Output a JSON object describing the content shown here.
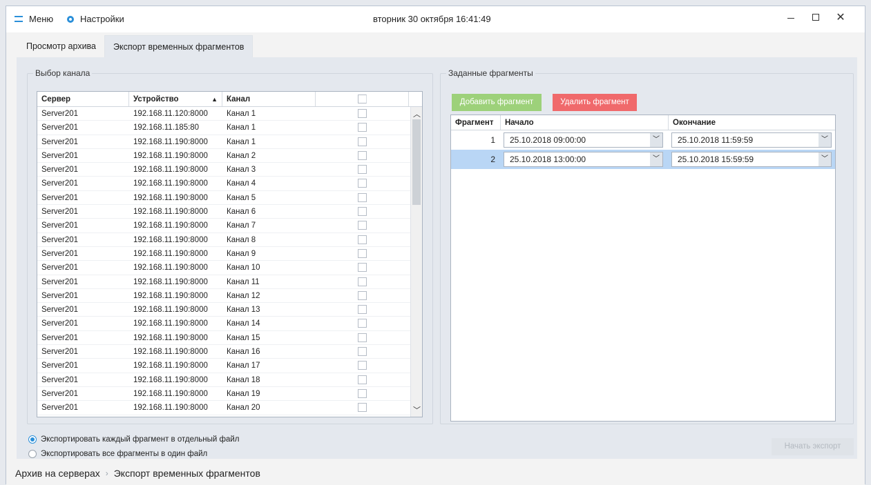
{
  "titlebar": {
    "menu_label": "Меню",
    "settings_label": "Настройки",
    "datetime": "вторник 30 октября 16:41:49"
  },
  "tabs": [
    {
      "label": "Просмотр архива",
      "active": false
    },
    {
      "label": "Экспорт временных фрагментов",
      "active": true
    }
  ],
  "channel_select": {
    "legend": "Выбор канала",
    "columns": {
      "server": "Сервер",
      "device": "Устройство",
      "channel": "Канал"
    },
    "rows": [
      {
        "server": "Server201",
        "device": "192.168.11.120:8000",
        "channel": "Канал 1"
      },
      {
        "server": "Server201",
        "device": "192.168.11.185:80",
        "channel": "Канал 1"
      },
      {
        "server": "Server201",
        "device": "192.168.11.190:8000",
        "channel": "Канал 1"
      },
      {
        "server": "Server201",
        "device": "192.168.11.190:8000",
        "channel": "Канал 2"
      },
      {
        "server": "Server201",
        "device": "192.168.11.190:8000",
        "channel": "Канал 3"
      },
      {
        "server": "Server201",
        "device": "192.168.11.190:8000",
        "channel": "Канал 4"
      },
      {
        "server": "Server201",
        "device": "192.168.11.190:8000",
        "channel": "Канал 5"
      },
      {
        "server": "Server201",
        "device": "192.168.11.190:8000",
        "channel": "Канал 6"
      },
      {
        "server": "Server201",
        "device": "192.168.11.190:8000",
        "channel": "Канал 7"
      },
      {
        "server": "Server201",
        "device": "192.168.11.190:8000",
        "channel": "Канал 8"
      },
      {
        "server": "Server201",
        "device": "192.168.11.190:8000",
        "channel": "Канал 9"
      },
      {
        "server": "Server201",
        "device": "192.168.11.190:8000",
        "channel": "Канал 10"
      },
      {
        "server": "Server201",
        "device": "192.168.11.190:8000",
        "channel": "Канал 11"
      },
      {
        "server": "Server201",
        "device": "192.168.11.190:8000",
        "channel": "Канал 12"
      },
      {
        "server": "Server201",
        "device": "192.168.11.190:8000",
        "channel": "Канал 13"
      },
      {
        "server": "Server201",
        "device": "192.168.11.190:8000",
        "channel": "Канал 14"
      },
      {
        "server": "Server201",
        "device": "192.168.11.190:8000",
        "channel": "Канал 15"
      },
      {
        "server": "Server201",
        "device": "192.168.11.190:8000",
        "channel": "Канал 16"
      },
      {
        "server": "Server201",
        "device": "192.168.11.190:8000",
        "channel": "Канал 17"
      },
      {
        "server": "Server201",
        "device": "192.168.11.190:8000",
        "channel": "Канал 18"
      },
      {
        "server": "Server201",
        "device": "192.168.11.190:8000",
        "channel": "Канал 19"
      },
      {
        "server": "Server201",
        "device": "192.168.11.190:8000",
        "channel": "Канал 20"
      }
    ]
  },
  "fragments": {
    "legend": "Заданные фрагменты",
    "add_label": "Добавить фрагмент",
    "delete_label": "Удалить фрагмент",
    "add_color": "#9dd17a",
    "delete_color": "#f0696b",
    "columns": {
      "fragment": "Фрагмент",
      "start": "Начало",
      "end": "Окончание"
    },
    "rows": [
      {
        "num": "1",
        "start": "25.10.2018  09:00:00",
        "end": "25.10.2018  11:59:59",
        "selected": false
      },
      {
        "num": "2",
        "start": "25.10.2018  13:00:00",
        "end": "25.10.2018  15:59:59",
        "selected": true
      }
    ]
  },
  "export_options": [
    {
      "label": "Экспортировать каждый фрагмент в отдельный файл",
      "checked": true
    },
    {
      "label": "Экспортировать все фрагменты в один файл",
      "checked": false
    }
  ],
  "start_export_label": "Начать экспорт",
  "breadcrumb": {
    "root": "Архив на серверах",
    "current": "Экспорт временных фрагментов"
  }
}
